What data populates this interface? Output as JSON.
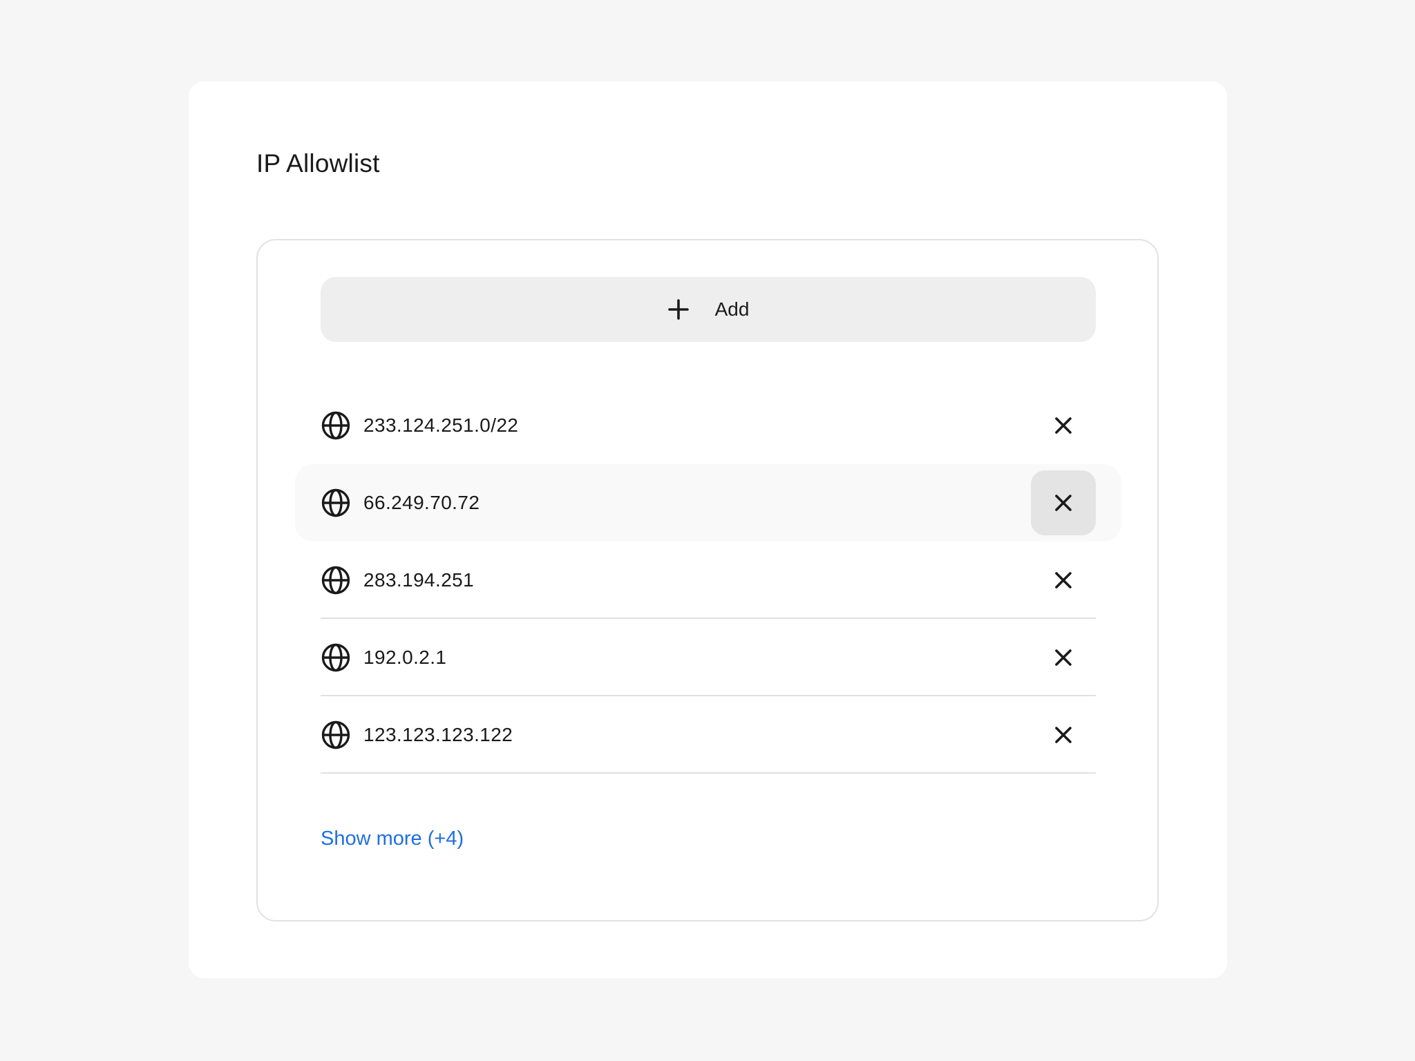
{
  "section": {
    "title": "IP Allowlist"
  },
  "add_button": {
    "label": "Add",
    "icon": "plus-icon"
  },
  "entries": [
    {
      "ip": "233.124.251.0/22",
      "icon": "globe-icon",
      "remove_icon": "close-icon"
    },
    {
      "ip": "66.249.70.72",
      "icon": "globe-icon",
      "remove_icon": "close-icon",
      "state": "hovered"
    },
    {
      "ip": "283.194.251",
      "icon": "globe-icon",
      "remove_icon": "close-icon"
    },
    {
      "ip": "192.0.2.1",
      "icon": "globe-icon",
      "remove_icon": "close-icon"
    },
    {
      "ip": "123.123.123.122",
      "icon": "globe-icon",
      "remove_icon": "close-icon"
    }
  ],
  "show_more": {
    "label": "Show more (+4)"
  },
  "colors": {
    "page_background": "#f6f6f6",
    "card_background": "#ffffff",
    "button_background": "#eeeeee",
    "hover_row_background": "#f9f9f9",
    "hover_button_background": "#e4e4e4",
    "link": "#1f6fe0",
    "text": "#1a1a1a"
  }
}
